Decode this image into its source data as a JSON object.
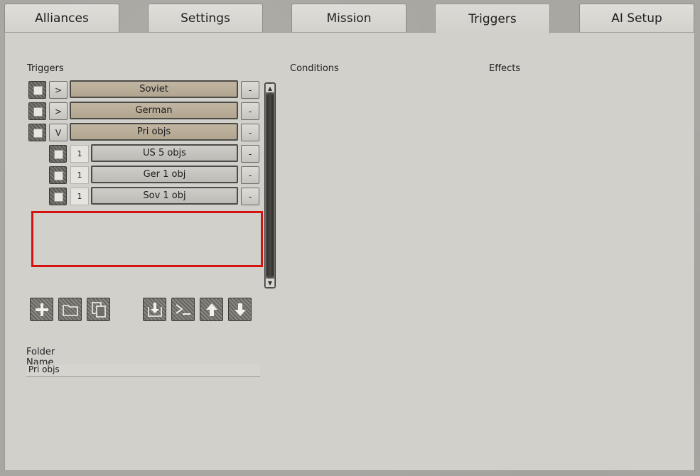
{
  "tabs": [
    {
      "label": "Alliances"
    },
    {
      "label": "Settings"
    },
    {
      "label": "Mission"
    },
    {
      "label": "Triggers",
      "active": true
    },
    {
      "label": "AI Setup"
    }
  ],
  "columns": {
    "triggers": "Triggers",
    "conditions": "Conditions",
    "effects": "Effects"
  },
  "trigger_rows": [
    {
      "toggle": ">",
      "label": "Soviet",
      "remove": "-"
    },
    {
      "toggle": ">",
      "label": "German",
      "remove": "-"
    },
    {
      "toggle": "V",
      "label": "Pri objs",
      "remove": "-"
    },
    {
      "number": "1",
      "label": "US 5 objs",
      "remove": "-"
    },
    {
      "number": "1",
      "label": "Ger 1 obj",
      "remove": "-"
    },
    {
      "number": "1",
      "label": "Sov 1 obj",
      "remove": "-"
    }
  ],
  "toolbar": {
    "left_icons": [
      "add-icon",
      "folder-icon",
      "copy-icon"
    ],
    "right_icons": [
      "import-icon",
      "console-icon",
      "move-up-icon",
      "move-down-icon"
    ]
  },
  "folder_name": {
    "label": "Folder Name",
    "value": "Pri objs"
  },
  "colors": {
    "highlight": "#d41313",
    "folder_bar": "#b8ac98",
    "panel": "#d2d0cb"
  }
}
